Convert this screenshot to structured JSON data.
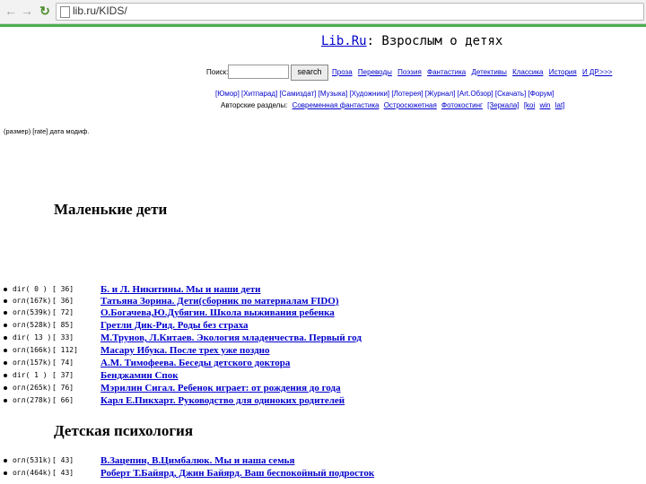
{
  "browser": {
    "url": "lib.ru/KIDS/"
  },
  "header": {
    "brand": "Lib.Ru",
    "title_suffix": ": Взрослым о детях"
  },
  "search": {
    "label": "Поиск:",
    "button": "search",
    "genres": [
      "Проза",
      "Переводы",
      "Поэзия",
      "Фантастика",
      "Детективы",
      "Классика",
      "История",
      "И ДР.>>>"
    ]
  },
  "sections_bar": "[Юмор] [Хитпарад] [Самиздат] [Музыка] [Художники] [Лотерея] [Журнал] [Art.Обзор] [Скачать] [Форум]",
  "authors_bar": {
    "label": "Авторские разделы:",
    "links": [
      "Современная фантастика",
      "Остросюжетная",
      "Фотокостинг",
      "[Зеркала]",
      "[koi",
      "win",
      "lat]"
    ]
  },
  "legend": "(размер) [rate] дата модиф.",
  "sections": [
    {
      "title": "Маленькие дети",
      "items": [
        {
          "kind": "dir(  0 )",
          "rate": "[   36]",
          "title": "Б. и Л. Никитины. Мы и наши дети"
        },
        {
          "kind": "огл(167k)",
          "rate": "[   36]",
          "title": "Татьяна Зорина. Дети(сборник по материалам FIDO)"
        },
        {
          "kind": "огл(539k)",
          "rate": "[   72]",
          "title": "О.Богачева,Ю.Дубягин. Школа выживания ребенка"
        },
        {
          "kind": "огл(528k)",
          "rate": "[   85]",
          "title": "Гретли Дик-Рид. Роды без страха"
        },
        {
          "kind": "dir( 13 )",
          "rate": "[   33]",
          "title": "М.Трунов, Л.Китаев. Экология младенчества. Первый год"
        },
        {
          "kind": "огл(166k)",
          "rate": "[  112]",
          "title": "Масару Ибука. После трех уже поздно"
        },
        {
          "kind": "огл(157k)",
          "rate": "[   74]",
          "title": "А.М. Тимофеева. Беседы детского доктора"
        },
        {
          "kind": "dir(  1 )",
          "rate": "[   37]",
          "title": "Бенджамин Спок"
        },
        {
          "kind": "огл(265k)",
          "rate": "[   76]",
          "title": "Мэрилин Сигал. Ребенок играет: от рождения до года"
        },
        {
          "kind": "огл(278k)",
          "rate": "[   66]",
          "title": "Карл Е.Пикхарт. Руководство для одиноких родителей"
        }
      ]
    },
    {
      "title": "Детская психология",
      "items": [
        {
          "kind": "огл(531k)",
          "rate": "[   43]",
          "title": "В.Зацепин, В.Цимбалюк. Мы и наша семья"
        },
        {
          "kind": "огл(464k)",
          "rate": "[   43]",
          "title": "Роберт Т.Байярд, Джин Байярд. Ваш беспокойный подросток"
        }
      ]
    }
  ]
}
